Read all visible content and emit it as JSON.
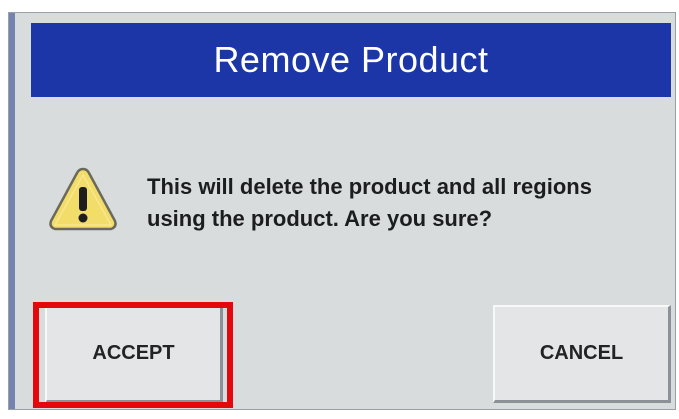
{
  "dialog": {
    "title": "Remove Product",
    "message_line1": "This will delete the product and all regions",
    "message_line2": "using the product.  Are you sure?",
    "icon": "warning-icon"
  },
  "buttons": {
    "accept_label": "ACCEPT",
    "cancel_label": "CANCEL"
  },
  "annotation": {
    "highlight_target": "accept-button",
    "highlight_color": "#e4080c"
  },
  "colors": {
    "title_bar": "#1c36a8",
    "dialog_background": "#d9dcdd",
    "warning_fill": "#f2dc6a"
  }
}
